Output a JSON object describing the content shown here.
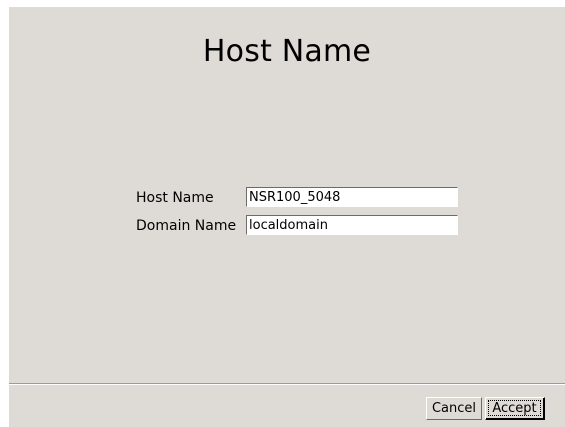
{
  "dialog": {
    "title": "Host Name"
  },
  "form": {
    "host_name": {
      "label": "Host Name",
      "value": "NSR100_5048"
    },
    "domain_name": {
      "label": "Domain Name",
      "value": "localdomain"
    }
  },
  "buttons": {
    "cancel_label": "Cancel",
    "accept_label": "Accept"
  },
  "colors": {
    "background": "#dedbd6",
    "field_background": "#ffffff"
  }
}
